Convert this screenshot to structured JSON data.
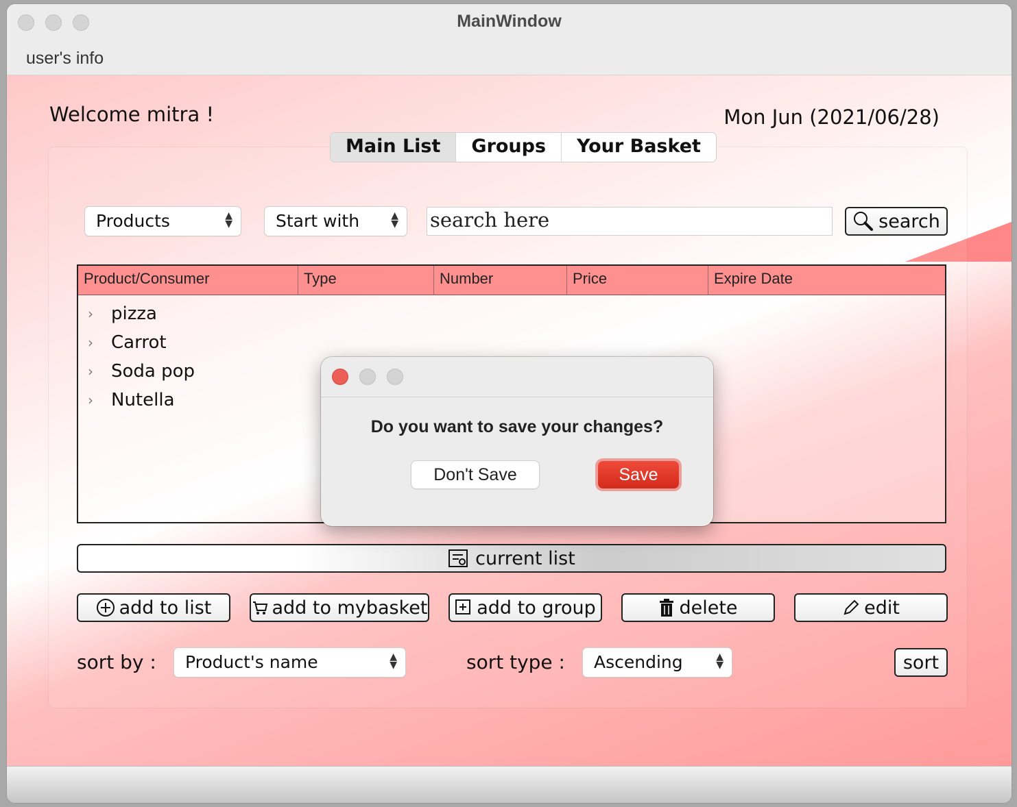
{
  "window": {
    "title": "MainWindow"
  },
  "menu": {
    "user_info": "user's info"
  },
  "header": {
    "welcome": "Welcome mitra !",
    "date": "Mon Jun (2021/06/28)"
  },
  "tabs": [
    {
      "label": "Main List",
      "active": true
    },
    {
      "label": "Groups",
      "active": false
    },
    {
      "label": "Your Basket",
      "active": false
    }
  ],
  "filters": {
    "category": "Products",
    "match": "Start with",
    "search_value": "search here",
    "search_button": "search"
  },
  "table": {
    "columns": [
      "Product/Consumer",
      "Type",
      "Number",
      "Price",
      "Expire Date"
    ],
    "rows": [
      "pizza",
      "Carrot",
      "Soda pop",
      "Nutella"
    ]
  },
  "actions": {
    "current_list": "current list",
    "add_to_list": "add to list",
    "add_to_mybasket": "add to mybasket",
    "add_to_group": "add to group",
    "delete": "delete",
    "edit": "edit"
  },
  "sort": {
    "sort_by_label": "sort by :",
    "sort_by_value": "Product's name",
    "sort_type_label": "sort type :",
    "sort_type_value": "Ascending",
    "sort_button": "sort"
  },
  "dialog": {
    "message": "Do you want to save your changes?",
    "dont_save": "Don't Save",
    "save": "Save"
  },
  "colors": {
    "table_header": "#ff9090",
    "save_button": "#e23a2c",
    "close_dot": "#ec5f57"
  }
}
